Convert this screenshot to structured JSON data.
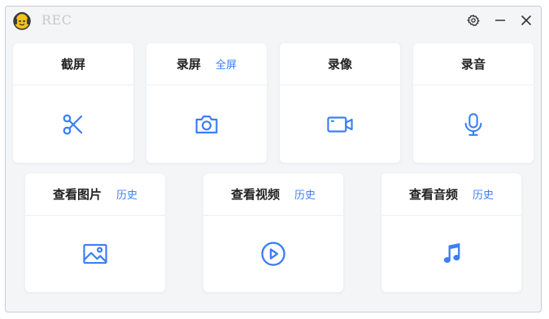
{
  "app": {
    "title": "REC"
  },
  "titlebar": {
    "icons": [
      "app-logo-icon",
      "gear-icon",
      "minimize-icon",
      "close-icon"
    ]
  },
  "cards": {
    "screenshot": {
      "title": "截屏",
      "icon": "scissors-icon"
    },
    "record_screen": {
      "title": "录屏",
      "link": "全屏",
      "icon": "camera-icon"
    },
    "record_video": {
      "title": "录像",
      "icon": "video-camera-icon"
    },
    "record_audio": {
      "title": "录音",
      "icon": "microphone-icon"
    },
    "view_images": {
      "title": "查看图片",
      "link": "历史",
      "icon": "image-icon"
    },
    "view_videos": {
      "title": "查看视频",
      "link": "历史",
      "icon": "play-circle-icon"
    },
    "view_audio": {
      "title": "查看音频",
      "link": "历史",
      "icon": "music-note-icon"
    }
  },
  "colors": {
    "accent": "#3b7ff3",
    "background": "#f4f5f7",
    "card": "#ffffff",
    "title_text": "#222222",
    "app_title_text": "#c8c8c8"
  }
}
